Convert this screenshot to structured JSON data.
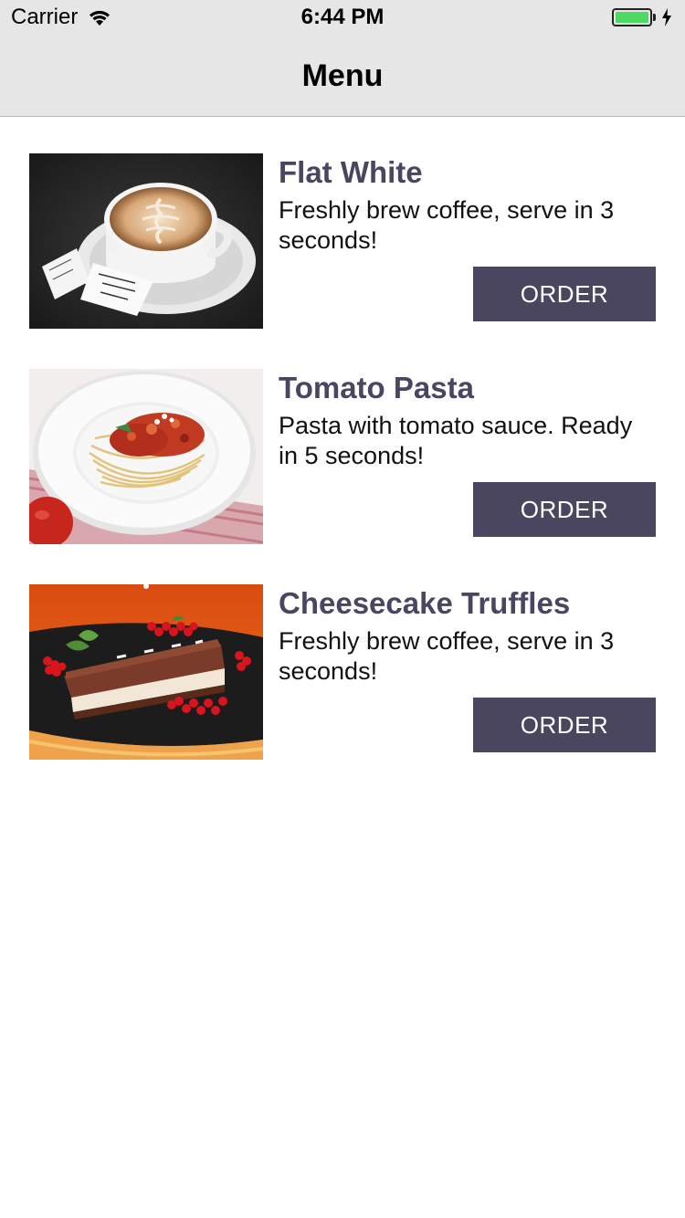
{
  "status_bar": {
    "carrier": "Carrier",
    "time": "6:44 PM",
    "battery_level": 1.0,
    "battery_color": "#4cd964",
    "wifi_icon": "wifi-icon",
    "charging_icon": "bolt-icon"
  },
  "nav": {
    "title": "Menu"
  },
  "colors": {
    "title_text": "#4a4560",
    "button_bg": "#4a4660",
    "button_text": "#ffffff",
    "nav_bg": "#e6e6e6"
  },
  "items": [
    {
      "title": "Flat White",
      "description": "Freshly brew coffee, serve in 3 seconds!",
      "button_label": "ORDER",
      "image": "flat-white-photo"
    },
    {
      "title": "Tomato Pasta",
      "description": "Pasta with tomato sauce. Ready in 5 seconds!",
      "button_label": "ORDER",
      "image": "tomato-pasta-photo"
    },
    {
      "title": "Cheesecake Truffles",
      "description": "Freshly brew coffee, serve in 3 seconds!",
      "button_label": "ORDER",
      "image": "cheesecake-photo"
    }
  ]
}
